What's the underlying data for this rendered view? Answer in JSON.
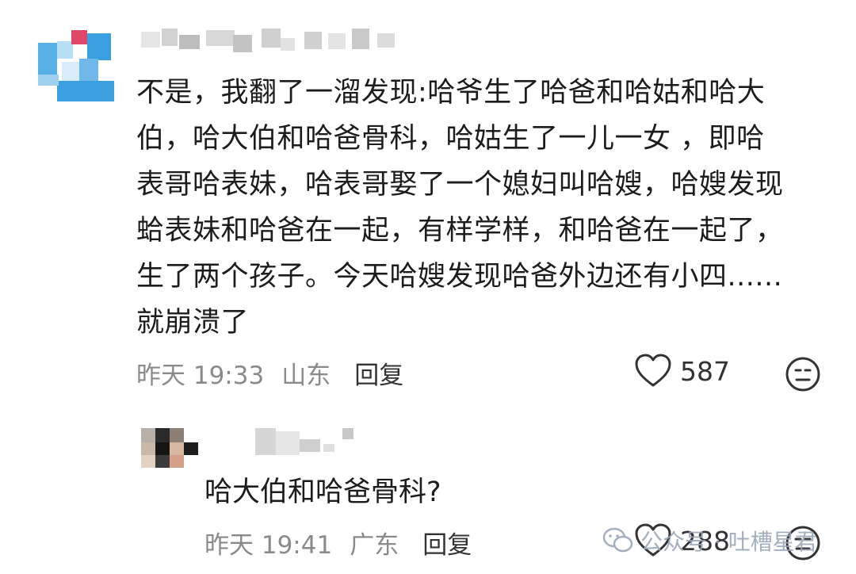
{
  "comment": {
    "lines": [
      "不是，我翻了一溜发现:哈爷生了哈爸和哈姑和哈大",
      "伯，哈大伯和哈爸骨科，哈姑生了一儿一女 ，即哈",
      "表哥哈表妹，哈表哥娶了一个媳妇叫哈嫂，哈嫂发现",
      "蛤表妹和哈爸在一起，有样学样，和哈爸在一起了，",
      "生了两个孩子。今天哈嫂发现哈爸外边还有小四......",
      "就崩溃了"
    ],
    "time": "昨天 19:33",
    "location": "山东",
    "reply_label": "回复",
    "likes": "587",
    "icons": {
      "like": "heart-icon",
      "emoji": "emoji-icon"
    }
  },
  "reply": {
    "text": "哈大伯和哈爸骨科?",
    "time": "昨天 19:41",
    "location": "广东",
    "reply_label": "回复",
    "likes": "288",
    "icons": {
      "like": "heart-icon",
      "emoji": "emoji-icon"
    }
  },
  "watermark": {
    "text": "公众号 · 吐槽星君",
    "icon": "wechat-icon"
  },
  "colors": {
    "text": "#1c1c1c",
    "meta": "#8a8a8a",
    "avatar_blue": "#3aa0e0",
    "avatar_pink": "#e0486a"
  }
}
